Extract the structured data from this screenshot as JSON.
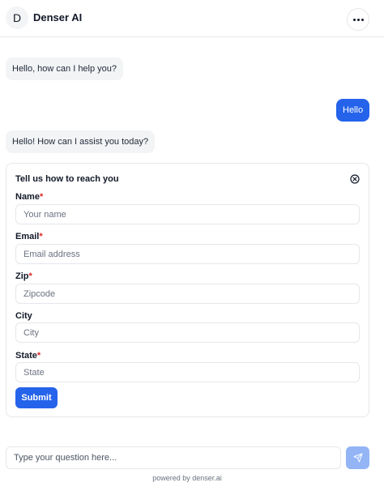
{
  "header": {
    "avatar_letter": "D",
    "title": "Denser AI",
    "menu_icon": "more-horizontal-icon"
  },
  "messages": [
    {
      "role": "bot",
      "text": "Hello, how can I help you?"
    },
    {
      "role": "user",
      "text": "Hello"
    },
    {
      "role": "bot",
      "text": "Hello! How can I assist you today?"
    }
  ],
  "contact_form": {
    "title": "Tell us how to reach you",
    "close_icon": "close-circle-icon",
    "fields": [
      {
        "label": "Name",
        "required": true,
        "placeholder": "Your name",
        "value": ""
      },
      {
        "label": "Email",
        "required": true,
        "placeholder": "Email address",
        "value": ""
      },
      {
        "label": "Zip",
        "required": true,
        "placeholder": "Zipcode",
        "value": ""
      },
      {
        "label": "City",
        "required": false,
        "placeholder": "City",
        "value": ""
      },
      {
        "label": "State",
        "required": true,
        "placeholder": "State",
        "value": ""
      }
    ],
    "submit_label": "Submit"
  },
  "composer": {
    "placeholder": "Type your question here...",
    "value": "",
    "send_icon": "send-icon"
  },
  "footer": {
    "powered_by": "powered by denser.ai"
  },
  "colors": {
    "accent": "#2563eb",
    "send_disabled": "#93b4f5",
    "required": "#dc2626",
    "bot_bubble": "#f3f4f6"
  }
}
